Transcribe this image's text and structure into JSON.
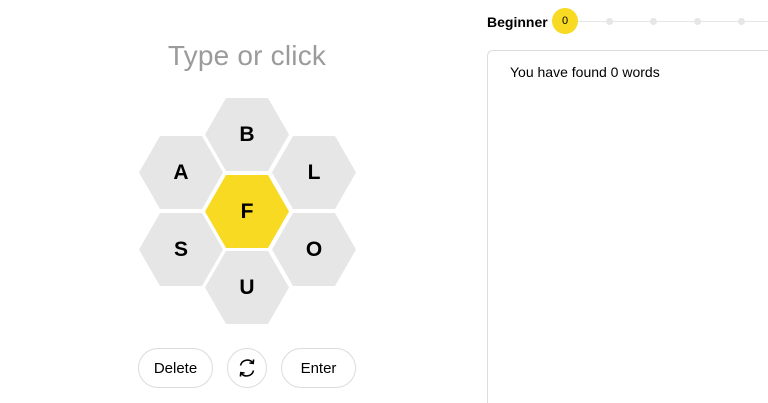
{
  "input": {
    "placeholder": "Type or click"
  },
  "colors": {
    "center": "#f7da21",
    "outer": "#e6e6e6",
    "border": "#dcdcdc",
    "placeholder": "#9b9b9b"
  },
  "hive": {
    "center_letter": "F",
    "outer_letters": {
      "top": "B",
      "upper_left": "A",
      "upper_right": "L",
      "lower_left": "S",
      "lower_right": "O",
      "bottom": "U"
    }
  },
  "controls": {
    "delete_label": "Delete",
    "shuffle_icon": "shuffle-icon",
    "enter_label": "Enter"
  },
  "progress": {
    "rank": "Beginner",
    "score": "0"
  },
  "words": {
    "found_text": "You have found 0 words"
  }
}
